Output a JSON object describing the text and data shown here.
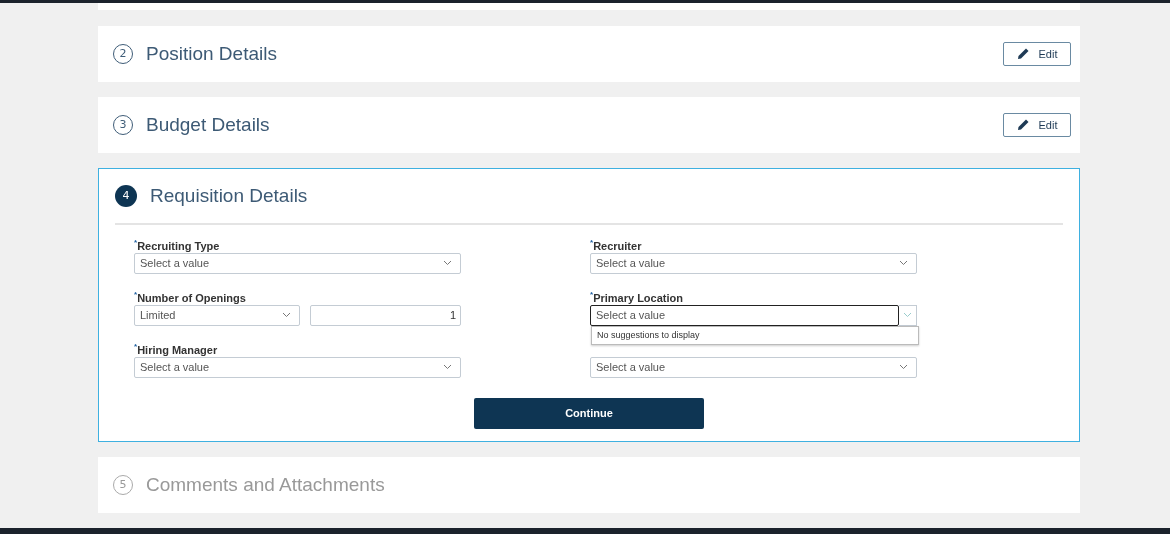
{
  "sections_before": [
    {
      "number": "2",
      "title": "Position Details",
      "done": true,
      "active": false,
      "action": "Edit"
    },
    {
      "number": "3",
      "title": "Budget Details",
      "done": true,
      "active": false,
      "action": "Edit"
    }
  ],
  "active_section": {
    "number": "4",
    "title": "Requisition Details",
    "active": true,
    "columns": [
      [
        {
          "kind": "select",
          "label": "$^{*}$Recruiting Type",
          "placeholder": "Select a value",
          "focused": false
        },
        {
          "kind": "split",
          "label": "$^{*}$Number of Openings",
          "value": "Limited",
          "number": "1"
        },
        {
          "kind": "select",
          "label": "$^{*}$Hiring Manager",
          "placeholder": "Select a value",
          "focused": false
        }
      ],
      [
        {
          "kind": "select",
          "label": "$^{*}$Recruiter",
          "placeholder": "Select a value",
          "focused": false
        },
        {
          "kind": "select",
          "label": "$^{*}$Primary Location",
          "placeholder": "Select a value",
          "focused": true,
          "suggestion": "No suggestions to display"
        },
        {
          "kind": "select",
          "placeholder": "Select a value",
          "focused": false
        }
      ]
    ],
    "button": "Continue"
  },
  "sections_after": [
    {
      "number": "5",
      "title": "Comments and Attachments",
      "done": false,
      "active": false
    }
  ]
}
